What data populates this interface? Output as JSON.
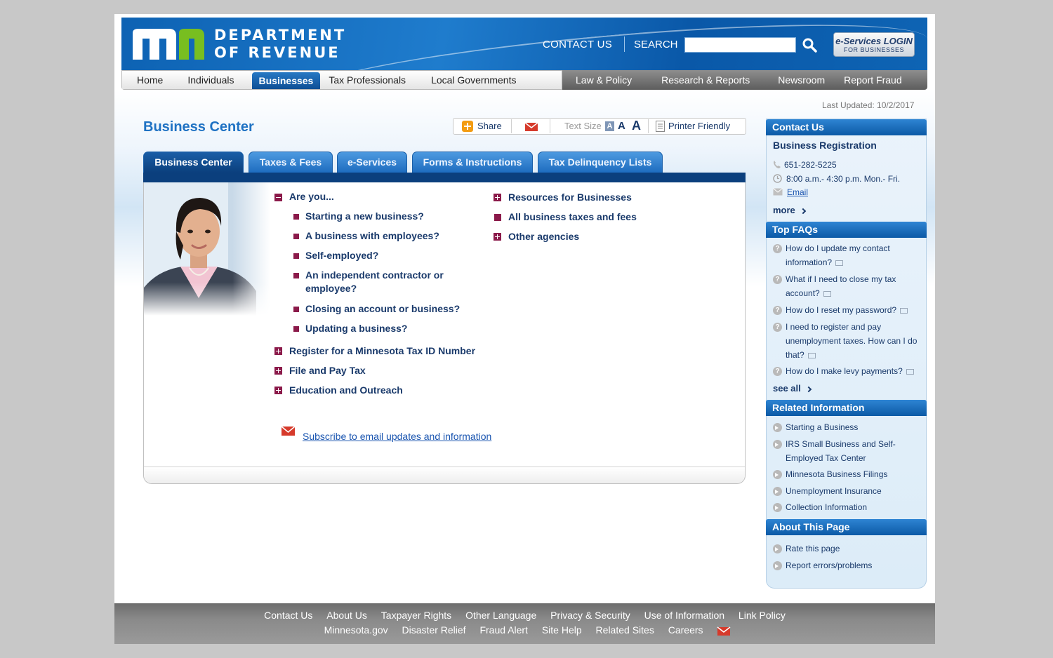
{
  "header": {
    "logo_line1": "DEPARTMENT",
    "logo_line2": "OF REVENUE",
    "contact_us": "CONTACT US",
    "search_label": "SEARCH",
    "search_value": "",
    "eservices_title": "e-Services LOGIN",
    "eservices_sub": "FOR BUSINESSES",
    "icons": [
      "mn-logo",
      "search-icon"
    ]
  },
  "nav": {
    "left": [
      "Home",
      "Individuals",
      "Businesses",
      "Tax Professionals",
      "Local Governments"
    ],
    "right": [
      "Law & Policy",
      "Research & Reports",
      "Newsroom",
      "Report Fraud"
    ],
    "active": "Businesses"
  },
  "last_updated": "Last Updated: 10/2/2017",
  "page_title": "Business Center",
  "toolbar": {
    "share": "Share",
    "text_size": "Text Size",
    "size_small": "A",
    "size_medium": "A",
    "size_large": "A",
    "printer_friendly": "Printer Friendly"
  },
  "tabs": [
    "Business Center",
    "Taxes & Fees",
    "e-Services",
    "Forms & Instructions",
    "Tax Delinquency Lists"
  ],
  "main": {
    "are_you": "Are you...",
    "sub_items": [
      "Starting a new business?",
      "A business with employees?",
      "Self-employed?",
      "An independent contractor or employee?",
      "Closing an account or business?",
      "Updating a business?"
    ],
    "collapsed_items": [
      "Register for a Minnesota Tax ID Number",
      "File and Pay Tax",
      "Education and Outreach"
    ],
    "right_items": [
      "Resources for Businesses",
      "All business taxes and fees",
      "Other agencies"
    ],
    "subscribe": "Subscribe to email updates and information"
  },
  "sidebar": {
    "contact": {
      "header": "Contact Us",
      "title": "Business Registration",
      "phone": "651-282-5225",
      "hours": "8:00 a.m.- 4:30 p.m. Mon.- Fri.",
      "email": "Email",
      "more": "more"
    },
    "faqs": {
      "header": "Top FAQs",
      "items": [
        "How do I update my contact information?",
        "What if I need to close my tax account?",
        "How do I reset my password?",
        "I need to register and pay unemployment taxes. How can I do that?",
        "How do I make levy payments?"
      ],
      "see_all": "see all"
    },
    "related": {
      "header": "Related Information",
      "items": [
        "Starting a Business",
        "IRS Small Business and Self-Employed Tax Center",
        "Minnesota Business Filings",
        "Unemployment Insurance",
        "Collection Information"
      ]
    },
    "about": {
      "header": "About This Page",
      "items": [
        "Rate this page",
        "Report errors/problems"
      ]
    }
  },
  "footer": {
    "row1": [
      "Contact Us",
      "About Us",
      "Taxpayer Rights",
      "Other Language",
      "Privacy & Security",
      "Use of Information",
      "Link Policy"
    ],
    "row2": [
      "Minnesota.gov",
      "Disaster Relief",
      "Fraud Alert",
      "Site Help",
      "Related Sites",
      "Careers"
    ]
  },
  "colors": {
    "brand_blue": "#1f72c3",
    "accent_maroon": "#8b1a4a",
    "nav_dark": "#0b3f7d"
  }
}
